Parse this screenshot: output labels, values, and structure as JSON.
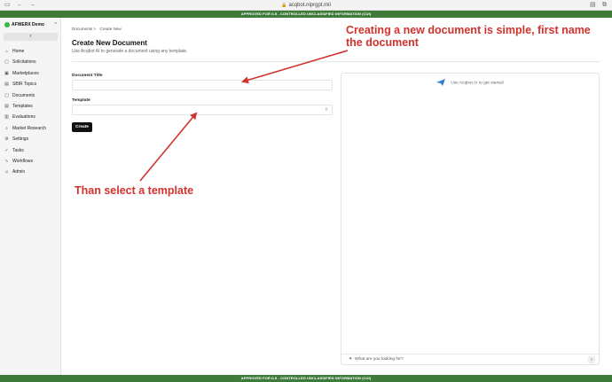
{
  "browser": {
    "url": "acqbot.niprgpt.mil",
    "icons": [
      "sidebar-icon",
      "back-icon",
      "forward-icon",
      "reader-icon",
      "tabs-icon"
    ]
  },
  "banners": {
    "top": "APPROVED FOR IL5 - CONTROLLED UNCLASSIFIED INFORMATION (CUI)",
    "bottom": "APPROVED FOR IL5 - CONTROLLED UNCLASSIFIED INFORMATION (CUI)"
  },
  "sidebar": {
    "org_name": "AFWERX Demo",
    "collapse_icon": "‹",
    "items": [
      {
        "label": "Home",
        "icon": "home-icon",
        "glyph": "⌂"
      },
      {
        "label": "Solicitations",
        "icon": "document-icon",
        "glyph": "▢"
      },
      {
        "label": "Marketplaces",
        "icon": "store-icon",
        "glyph": "▣"
      },
      {
        "label": "SBIR Topics",
        "icon": "topics-icon",
        "glyph": "▤"
      },
      {
        "label": "Documents",
        "icon": "file-icon",
        "glyph": "▢"
      },
      {
        "label": "Templates",
        "icon": "template-icon",
        "glyph": "▤"
      },
      {
        "label": "Evaluations",
        "icon": "clipboard-icon",
        "glyph": "▥"
      },
      {
        "label": "Market Research",
        "icon": "search-icon",
        "glyph": "⌕"
      },
      {
        "label": "Settings",
        "icon": "gear-icon",
        "glyph": "⚙"
      },
      {
        "label": "Tasks",
        "icon": "check-icon",
        "glyph": "✓"
      },
      {
        "label": "Workflows",
        "icon": "workflow-icon",
        "glyph": "∿"
      },
      {
        "label": "Admin",
        "icon": "user-icon",
        "glyph": "☺"
      }
    ]
  },
  "main": {
    "breadcrumb": [
      "Documents >",
      "Create New"
    ],
    "title": "Create New Document",
    "subtitle": "Use Acqbot AI to generate a document using any template.",
    "form": {
      "title_label": "Document Title",
      "title_value": "",
      "template_label": "Template",
      "template_value": "",
      "create_label": "Create"
    }
  },
  "chat": {
    "hint": "Use Acqbot AI to get started",
    "input_placeholder": "What are you looking for?"
  },
  "annotations": {
    "first": "Creating a new document is simple, first name the document",
    "second": "Than select a template",
    "color": "#d1322e"
  },
  "colors": {
    "banner": "#3e7b3a",
    "org_dot": "#39b54a",
    "accent": "#2f7fd8"
  }
}
